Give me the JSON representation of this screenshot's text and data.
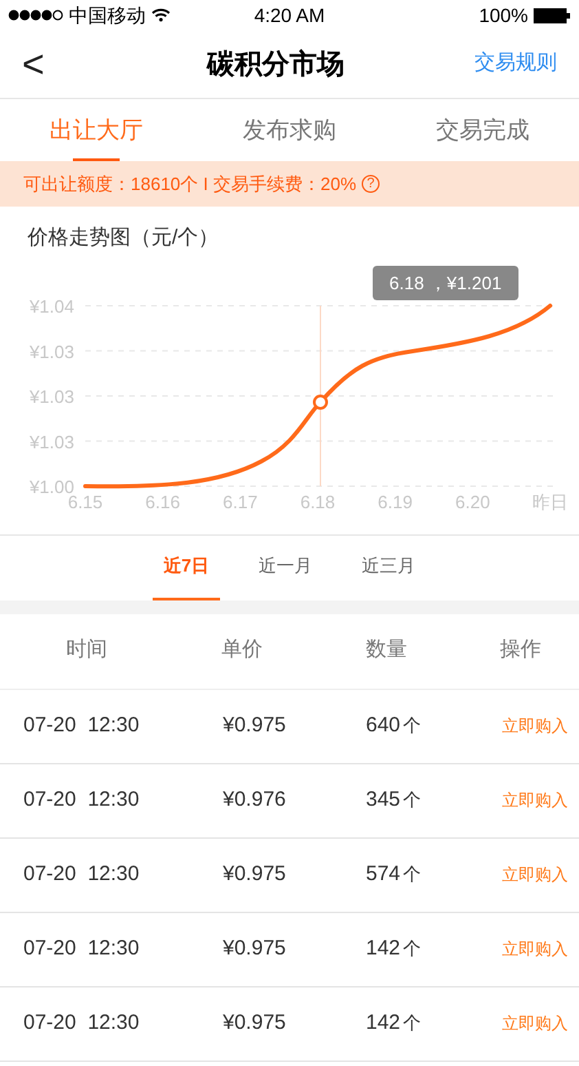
{
  "status_bar": {
    "carrier": "中国移动",
    "time": "4:20 AM",
    "battery": "100%"
  },
  "nav": {
    "back": "<",
    "title": "碳积分市场",
    "action": "交易规则"
  },
  "tabs": [
    {
      "label": "出让大厅",
      "selected": true
    },
    {
      "label": "发布求购",
      "selected": false
    },
    {
      "label": "交易完成",
      "selected": false
    }
  ],
  "notice": {
    "text": "可出让额度：18610个 I 交易手续费：20%",
    "help": "?"
  },
  "chart": {
    "title": "价格走势图（元/个）",
    "tooltip": "6.18 ，¥1.201",
    "y_labels": [
      "¥1.04",
      "¥1.03",
      "¥1.03",
      "¥1.03",
      "¥1.00"
    ],
    "x_labels": [
      "6.15",
      "6.16",
      "6.17",
      "6.18",
      "6.19",
      "6.20",
      "昨日"
    ]
  },
  "ranges": [
    {
      "label": "近7日",
      "selected": true
    },
    {
      "label": "近一月",
      "selected": false
    },
    {
      "label": "近三月",
      "selected": false
    }
  ],
  "table": {
    "columns": [
      "时间",
      "单价",
      "数量",
      "操作"
    ],
    "rows": [
      {
        "time": "07-20  12:30",
        "price": "¥0.975",
        "qty": "640",
        "unit": "个",
        "action": "立即购入"
      },
      {
        "time": "07-20  12:30",
        "price": "¥0.976",
        "qty": "345",
        "unit": "个",
        "action": "立即购入"
      },
      {
        "time": "07-20  12:30",
        "price": "¥0.975",
        "qty": "574",
        "unit": "个",
        "action": "立即购入"
      },
      {
        "time": "07-20  12:30",
        "price": "¥0.975",
        "qty": "142",
        "unit": "个",
        "action": "立即购入"
      },
      {
        "time": "07-20  12:30",
        "price": "¥0.975",
        "qty": "142",
        "unit": "个",
        "action": "立即购入"
      }
    ]
  }
}
